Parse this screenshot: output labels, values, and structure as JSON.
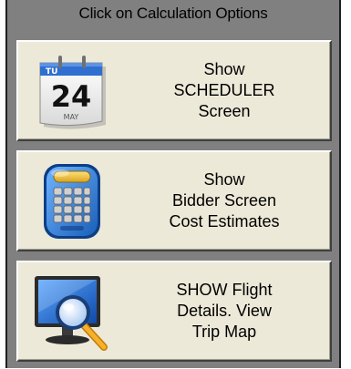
{
  "panel": {
    "title": "Click on Calculation Options"
  },
  "options": [
    {
      "icon": "calendar-icon",
      "calendar": {
        "weekday": "TU",
        "day": "24",
        "month": "MAY"
      },
      "label_lines": [
        "Show",
        "SCHEDULER",
        "Screen"
      ]
    },
    {
      "icon": "calculator-icon",
      "label_lines": [
        "Show",
        "Bidder Screen",
        "Cost Estimates"
      ]
    },
    {
      "icon": "monitor-magnifier-icon",
      "label_lines": [
        "SHOW Flight",
        "Details. View",
        "Trip Map"
      ]
    }
  ],
  "colors": {
    "panel_bg": "#808080",
    "button_face": "#ece9d8",
    "calendar_red": "#cc2b2b",
    "calculator_blue": "#2f7fd6",
    "monitor_blue": "#1e64c8",
    "magnifier_handle": "#f0a020"
  }
}
